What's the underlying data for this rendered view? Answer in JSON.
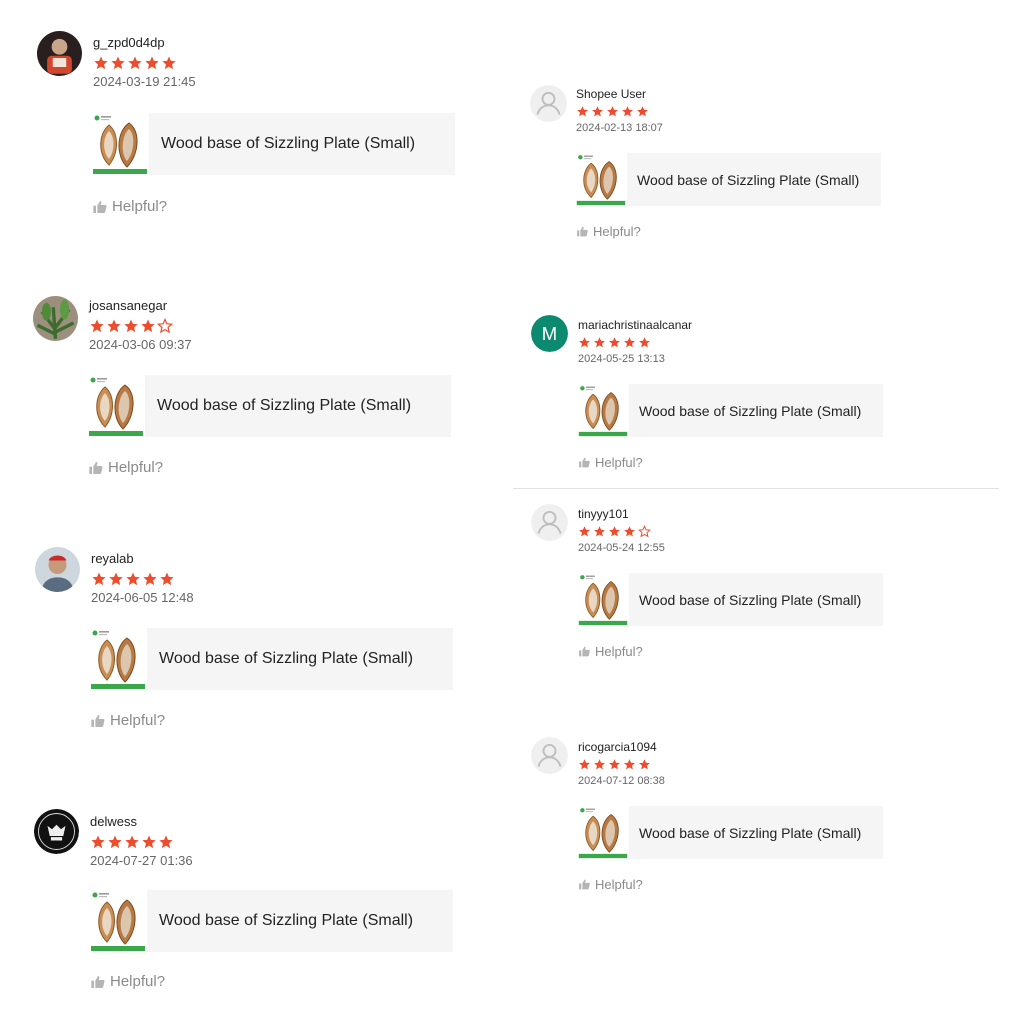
{
  "product_name": "Wood base of Sizzling Plate (Small)",
  "product_thumb_caption": "Wood base of Sizzling Plate",
  "helpful_label": "Helpful?",
  "colors": {
    "star": "#ee4d2d",
    "card_bg": "#f5f5f5",
    "helpful": "#8a8a8a",
    "avatar_m": "#0b8a70",
    "thumb_caption_bg": "#3aa84a"
  },
  "reviews": [
    {
      "username": "g_zpd0d4dp",
      "rating": 5,
      "date": "2024-03-19 21:45",
      "avatar": "photo-food-icon"
    },
    {
      "username": "josansanegar",
      "rating": 4,
      "date": "2024-03-06 09:37",
      "avatar": "photo-plant-icon"
    },
    {
      "username": "reyalab",
      "rating": 5,
      "date": "2024-06-05 12:48",
      "avatar": "photo-person-icon"
    },
    {
      "username": "delwess",
      "rating": 5,
      "date": "2024-07-27 01:36",
      "avatar": "photo-logo-icon"
    },
    {
      "username": "Shopee User",
      "rating": 5,
      "date": "2024-02-13 18:07",
      "avatar": "default-user-icon"
    },
    {
      "username": "mariachristinaalcanar",
      "rating": 5,
      "date": "2024-05-25 13:13",
      "avatar": "letter-avatar",
      "avatar_letter": "M"
    },
    {
      "username": "tinyyy101",
      "rating": 4,
      "date": "2024-05-24 12:55",
      "avatar": "default-user-icon"
    },
    {
      "username": "ricogarcia1094",
      "rating": 5,
      "date": "2024-07-12 08:38",
      "avatar": "default-user-icon"
    }
  ]
}
